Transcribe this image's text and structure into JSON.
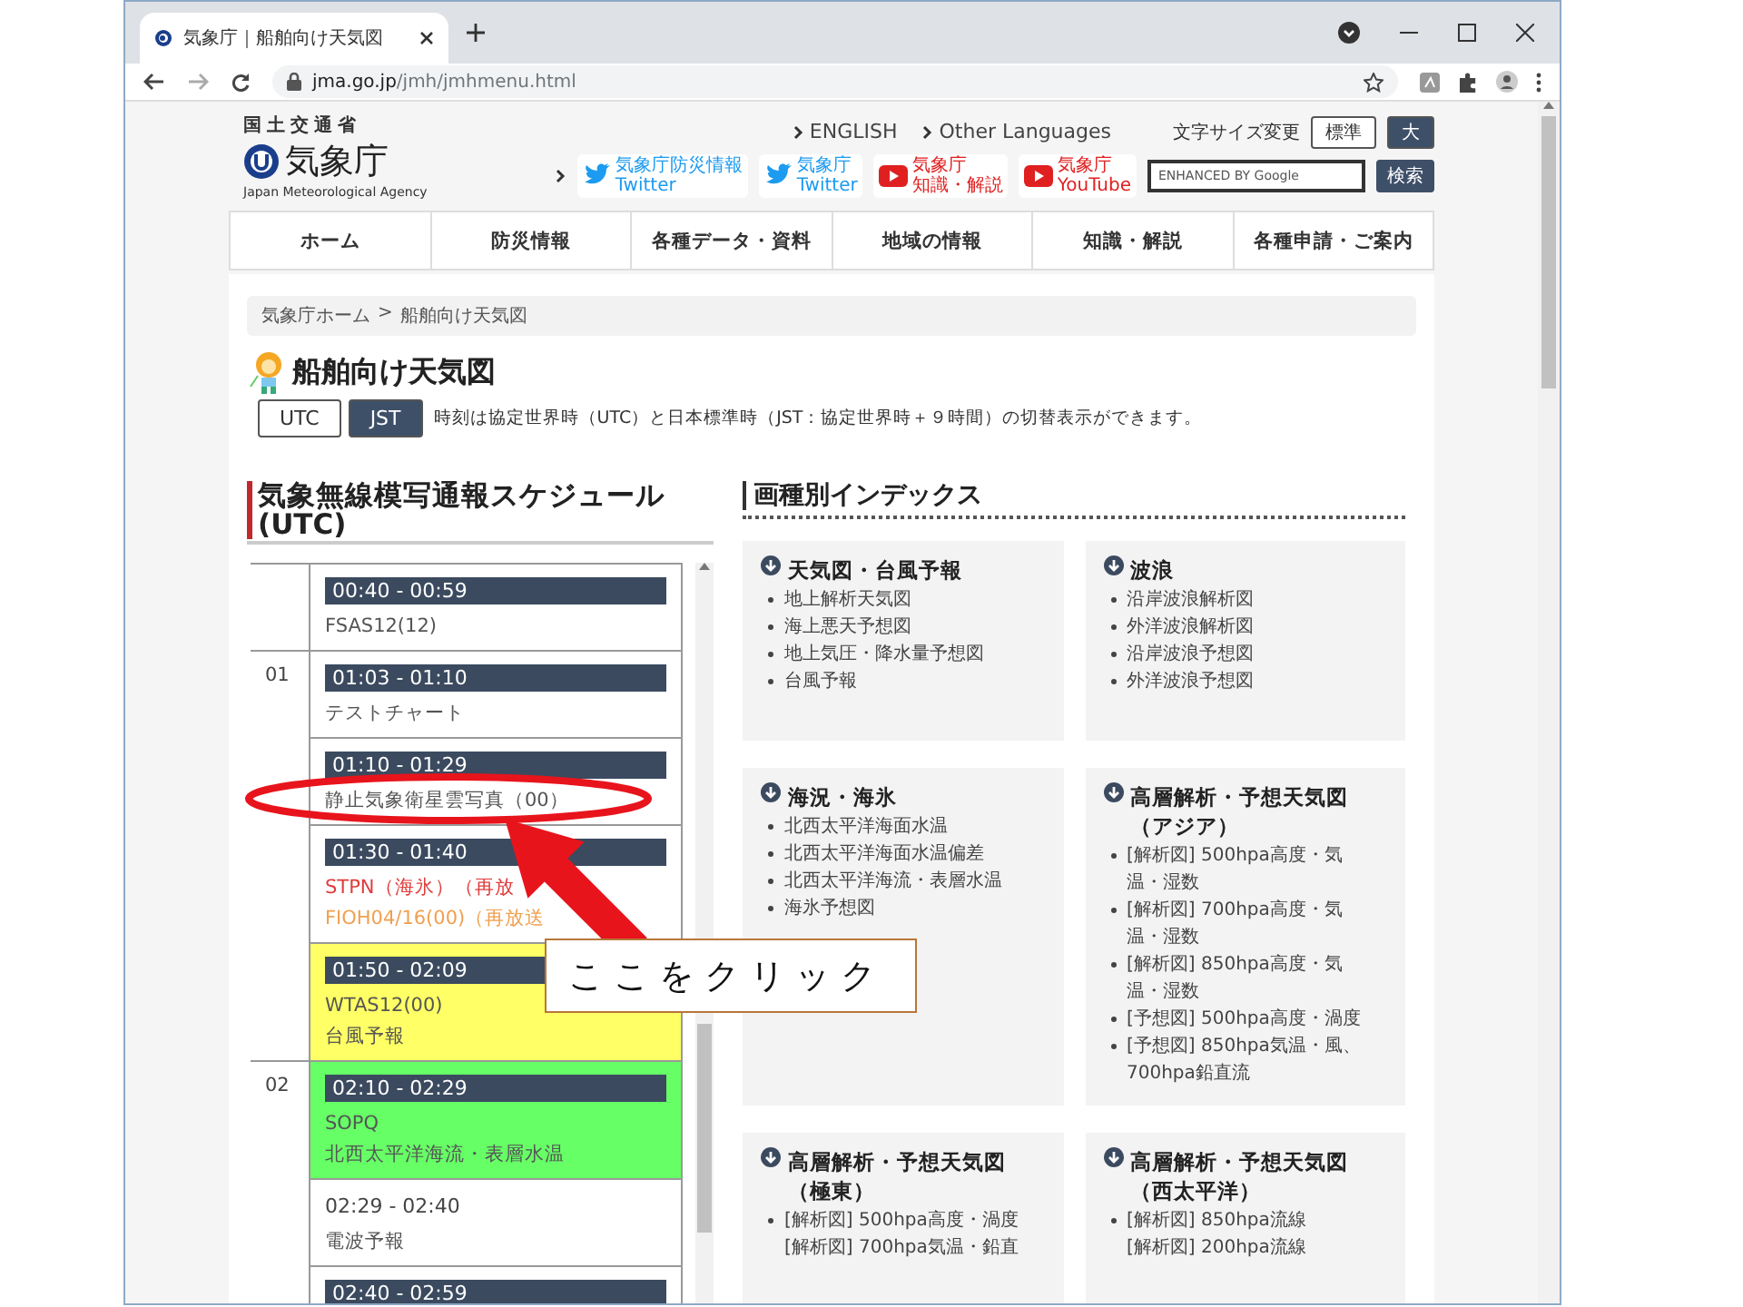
{
  "browser": {
    "tab_title": "気象庁｜船舶向け天気図",
    "url_host": "jma.go.jp",
    "url_path": "/jmh/jmhmenu.html"
  },
  "header": {
    "ministry": "国土交通省",
    "agency": "気象庁",
    "agency_en": "Japan Meteorological Agency",
    "lang_links": [
      "ENGLISH",
      "Other Languages"
    ],
    "font_size_label": "文字サイズ変更",
    "font_sizes": [
      {
        "label": "標準",
        "selected": true
      },
      {
        "label": "大",
        "selected": false
      }
    ],
    "social": [
      {
        "kind": "twitter",
        "line1": "気象庁防災情報",
        "line2": "Twitter"
      },
      {
        "kind": "twitter",
        "line1": "気象庁",
        "line2": "Twitter"
      },
      {
        "kind": "youtube",
        "line1": "気象庁",
        "line2": "知識・解説"
      },
      {
        "kind": "youtube",
        "line1": "気象庁",
        "line2": "YouTube"
      }
    ],
    "search_placeholder": "ENHANCED BY Google",
    "search_button": "検索"
  },
  "nav": [
    "ホーム",
    "防災情報",
    "各種データ・資料",
    "地域の情報",
    "知識・解説",
    "各種申請・ご案内"
  ],
  "breadcrumb": {
    "items": [
      "気象庁ホーム",
      "船舶向け天気図"
    ],
    "separator": ">"
  },
  "page_title": "船舶向け天気図",
  "time_toggle": [
    {
      "label": "UTC",
      "selected": true
    },
    {
      "label": "JST",
      "selected": false
    }
  ],
  "time_note": "時刻は協定世界時（UTC）と日本標準時（JST：協定世界時＋９時間）の切替表示ができます。",
  "schedule": {
    "title": "気象無線模写通報スケジュール (UTC)",
    "groups": [
      {
        "entries": [
          {
            "time": "00:40 - 00:59",
            "kind": "bar",
            "lines": [
              {
                "text": "FSAS12(12)"
              }
            ]
          }
        ]
      },
      {
        "hour": "01",
        "entries": [
          {
            "time": "01:03 - 01:10",
            "kind": "bar",
            "lines": [
              {
                "text": "テストチャート"
              }
            ]
          },
          {
            "time": "01:10 - 01:29",
            "kind": "bar",
            "lines": [
              {
                "text": "静止気象衛星雲写真（00）"
              }
            ]
          },
          {
            "time": "01:30 - 01:40",
            "kind": "bar",
            "lines": [
              {
                "text": "STPN（海氷）（再放",
                "color": "#e03c3c"
              },
              {
                "text": "FIOH04/16(00)（再放送",
                "color": "#f0a050"
              }
            ]
          },
          {
            "time": "01:50 - 02:09",
            "kind": "bar",
            "color": "#ffff66",
            "lines": [
              {
                "text": "WTAS12(00)"
              },
              {
                "text": "台風予報"
              }
            ]
          }
        ]
      },
      {
        "hour": "02",
        "entries": [
          {
            "time": "02:10 - 02:29",
            "kind": "bar",
            "color": "#66ff66",
            "lines": [
              {
                "text": "SOPQ"
              },
              {
                "text": "北西太平洋海流・表層水温"
              }
            ]
          },
          {
            "time": "02:29 - 02:40",
            "kind": "plain",
            "lines": [
              {
                "text": "電波予報"
              }
            ]
          },
          {
            "time": "02:40 - 02:59",
            "kind": "bar"
          }
        ]
      }
    ]
  },
  "index": {
    "title": "画種別インデックス",
    "cards": [
      {
        "title_lines": [
          "天気図・台風予報"
        ],
        "items": [
          {
            "lines": [
              "地上解析天気図"
            ]
          },
          {
            "lines": [
              "海上悪天予想図"
            ]
          },
          {
            "lines": [
              "地上気圧・降水量予想図"
            ]
          },
          {
            "lines": [
              "台風予報"
            ]
          }
        ]
      },
      {
        "title_lines": [
          "波浪"
        ],
        "items": [
          {
            "lines": [
              "沿岸波浪解析図"
            ]
          },
          {
            "lines": [
              "外洋波浪解析図"
            ]
          },
          {
            "lines": [
              "沿岸波浪予想図"
            ]
          },
          {
            "lines": [
              "外洋波浪予想図"
            ]
          }
        ]
      },
      {
        "title_lines": [
          "海況・海氷"
        ],
        "items": [
          {
            "lines": [
              "北西太平洋海面水温"
            ]
          },
          {
            "lines": [
              "北西太平洋海面水温偏差"
            ]
          },
          {
            "lines": [
              "北西太平洋海流・表層水温"
            ]
          },
          {
            "lines": [
              "海氷予想図"
            ]
          }
        ]
      },
      {
        "title_lines": [
          "高層解析・予想天気図",
          "（アジア）"
        ],
        "items": [
          {
            "lines": [
              "[解析図] 500hpa高度・気",
              "温・湿数"
            ]
          },
          {
            "lines": [
              "[解析図] 700hpa高度・気",
              "温・湿数"
            ]
          },
          {
            "lines": [
              "[解析図] 850hpa高度・気",
              "温・湿数"
            ]
          },
          {
            "lines": [
              "[予想図] 500hpa高度・渦度"
            ]
          },
          {
            "lines": [
              "[予想図] 850hpa気温・風、",
              "700hpa鉛直流"
            ]
          }
        ]
      },
      {
        "title_lines": [
          "高層解析・予想天気図",
          "（極東）"
        ],
        "items": [
          {
            "lines": [
              "[解析図] 500hpa高度・渦度",
              "[解析図] 700hpa気温・鉛直"
            ]
          }
        ]
      },
      {
        "title_lines": [
          "高層解析・予想天気図",
          "（西太平洋）"
        ],
        "items": [
          {
            "lines": [
              "[解析図] 850hpa流線",
              "[解析図] 200hpa流線"
            ]
          }
        ]
      }
    ]
  },
  "annotation": {
    "callout": "ここをクリック"
  }
}
